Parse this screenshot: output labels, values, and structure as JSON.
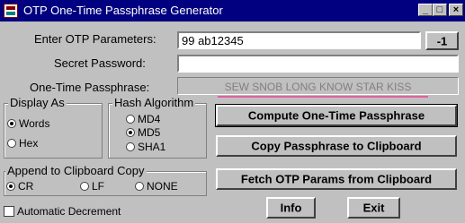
{
  "window": {
    "title": "OTP One-Time Passphrase Generator",
    "minimize_icon": "minimize-icon",
    "maximize_icon": "maximize-icon",
    "close_icon": "close-icon"
  },
  "fields": {
    "otp_params_label": "Enter OTP Parameters:",
    "otp_params_value": "99 ab12345",
    "secret_label": "Secret Password:",
    "secret_value": "",
    "passphrase_label": "One-Time Passphrase:",
    "passphrase_value": "SEW SNOB LONG KNOW STAR KISS"
  },
  "buttons": {
    "decrement": "-1",
    "compute": "Compute One-Time Passphrase",
    "copy": "Copy Passphrase to Clipboard",
    "fetch": "Fetch OTP Params from Clipboard",
    "info": "Info",
    "exit": "Exit"
  },
  "display_as": {
    "title": "Display As",
    "options": [
      {
        "label": "Words",
        "selected": true
      },
      {
        "label": "Hex",
        "selected": false
      }
    ]
  },
  "hash_algorithm": {
    "title": "Hash Algorithm",
    "options": [
      {
        "label": "MD4",
        "selected": false
      },
      {
        "label": "MD5",
        "selected": true
      },
      {
        "label": "SHA1",
        "selected": false
      }
    ]
  },
  "append_copy": {
    "title": "Append to Clipboard Copy",
    "options": [
      {
        "label": "CR",
        "selected": true
      },
      {
        "label": "LF",
        "selected": false
      },
      {
        "label": "NONE",
        "selected": false
      }
    ]
  },
  "auto_decrement": {
    "label": "Automatic Decrement",
    "checked": false
  },
  "colors": {
    "titlebar": "#000080",
    "face": "#c0c0c0",
    "passphrase_text": "#808080",
    "underline": "#e060a0"
  }
}
